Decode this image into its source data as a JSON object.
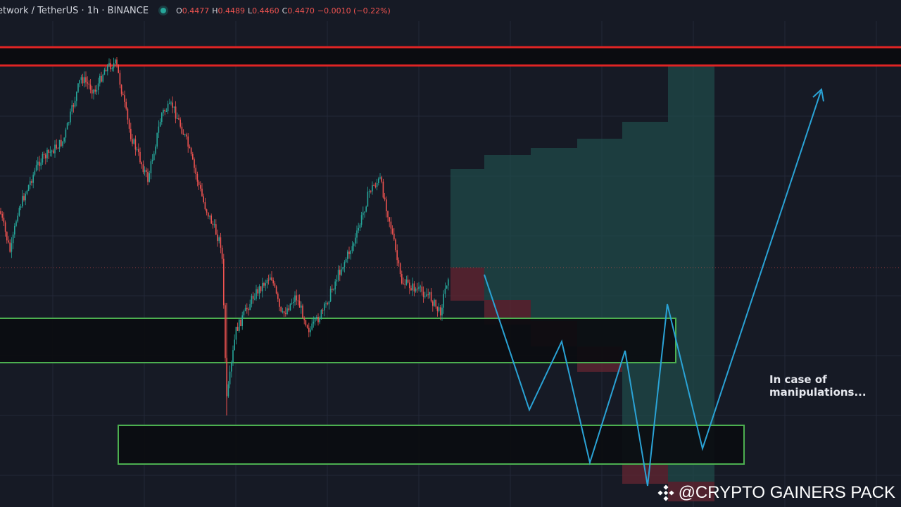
{
  "header": {
    "title": "etwork / TetherUS · 1h · BINANCE",
    "ohlc": [
      {
        "k": "O",
        "v": "0.4477"
      },
      {
        "k": "H",
        "v": "0.4489"
      },
      {
        "k": "L",
        "v": "0.4460"
      },
      {
        "k": "C",
        "v": "0.4470"
      }
    ],
    "change": "−0.0010 (−0.22%)"
  },
  "annotation": {
    "line1": "In case of",
    "line2": "manipulations..."
  },
  "watermark": {
    "text": "@CRYPTO GAINERS PACK",
    "icon": "binance-logo-icon"
  },
  "colors": {
    "background": "#161a25",
    "up": "#26a69a",
    "down": "#ef5350",
    "resistance_zone": "#e02424",
    "support_zone": "#4caf50",
    "projection": "#2aa3d6"
  },
  "chart_data": {
    "type": "candlestick",
    "symbol": "etwork / TetherUS",
    "timeframe": "1h",
    "exchange": "BINANCE",
    "last_close": 0.447,
    "zones": [
      {
        "kind": "resistance",
        "color": "red"
      },
      {
        "kind": "support",
        "color": "green"
      },
      {
        "kind": "support",
        "color": "green"
      }
    ],
    "projection": {
      "type": "zigzag",
      "note": "In case of manipulations..."
    }
  }
}
